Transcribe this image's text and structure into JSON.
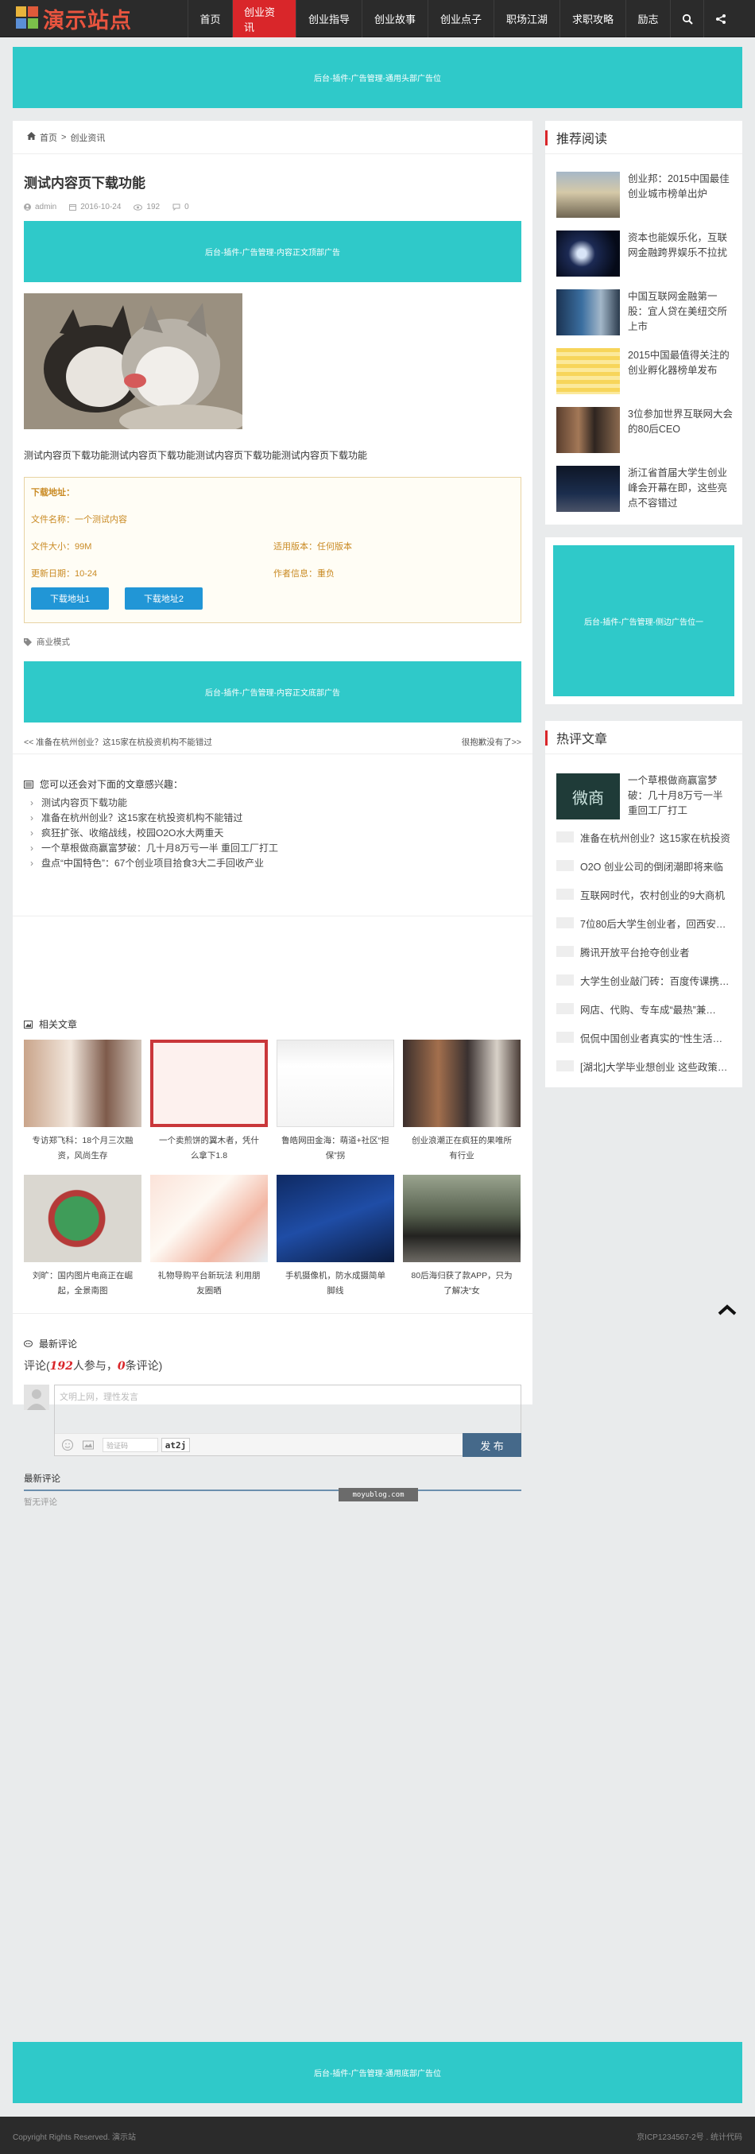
{
  "header": {
    "logo_text": "演示站点",
    "nav": [
      "首页",
      "创业资讯",
      "创业指导",
      "创业故事",
      "创业点子",
      "职场江湖",
      "求职攻略",
      "励志"
    ],
    "active_nav": "创业资讯"
  },
  "ads": {
    "top": "后台-插件-广告管理-通用头部广告位",
    "content_top": "后台-插件-广告管理-内容正文顶部广告",
    "content_bottom": "后台-插件-广告管理-内容正文底部广告",
    "side": "后台-插件-广告管理-侧边广告位一",
    "footer": "后台-插件-广告管理-通用底部广告位"
  },
  "breadcrumb": {
    "home": "首页",
    "sep": ">",
    "current": "创业资讯"
  },
  "article": {
    "title": "测试内容页下载功能",
    "author": "admin",
    "date": "2016-10-24",
    "views": "192",
    "comments": "0",
    "body": "测试内容页下载功能测试内容页下载功能测试内容页下载功能测试内容页下载功能"
  },
  "download": {
    "heading": "下载地址：",
    "name": "文件名称：一个测试内容",
    "size": "文件大小：99M",
    "version": "适用版本：任何版本",
    "updated": "更新日期：10-24",
    "author": "作者信息：重负",
    "btn1": "下载地址1",
    "btn2": "下载地址2"
  },
  "tag": "商业模式",
  "prev_next": {
    "prev": "<< 准备在杭州创业？这15家在杭投资机构不能错过",
    "next": "很抱歉没有了>>"
  },
  "recommend": {
    "heading": "您可以还会对下面的文章感兴趣：",
    "items": [
      "测试内容页下载功能",
      "准备在杭州创业？这15家在杭投资机构不能错过",
      "疯狂扩张、收缩战线，校园O2O水大两重天",
      "一个草根做商赢富梦破：几十月8万亏一半 重回工厂打工",
      "盘点“中国特色”：67个创业项目拾食3大二手回收产业"
    ]
  },
  "related": {
    "heading": "相关文章",
    "items": [
      "专访郑飞科：18个月三次融资，风尚生存",
      "一个卖煎饼的翼木者，凭什么拿下1.8",
      "鲁皓网田金海：萌道+社区“担保”拐",
      "创业浪潮正在疯狂的果唯所有行业",
      "刘旷：国内图片电商正在崛起，全景南图",
      "礼物导购平台新玩法 利用朋友圈晒",
      "手机摄像机，防水成摄简单脚线",
      "80后海归获了款APP，只为了解决“女"
    ]
  },
  "comments": {
    "heading": "最新评论",
    "count_prefix": "评论(",
    "participants": "192",
    "mid": "人参与，",
    "count": "0",
    "suffix": "条评论)",
    "placeholder": "文明上网，理性发言",
    "captcha_label": "验证码",
    "captcha_code": "at2j",
    "submit": "发 布",
    "latest_heading": "最新评论",
    "empty": "暂无评论"
  },
  "sidebar": {
    "recommended_title": "推荐阅读",
    "recommended": [
      "创业邦：2015中国最佳创业城市榜单出炉",
      "资本也能娱乐化，互联网金融跨界娱乐不拉扰",
      "中国互联网金融第一股：宜人贷在美纽交所上市",
      "2015中国最值得关注的创业孵化器榜单发布",
      "3位参加世界互联网大会的80后CEO",
      "浙江省首届大学生创业峰会开幕在即，这些亮点不容错过"
    ],
    "hot_title": "热评文章",
    "hot_top": "一个草根做商赢富梦破：几十月8万亏一半 重回工厂打工",
    "hot_top_thumb_text": "微商",
    "hot": [
      "准备在杭州创业？这15家在杭投资",
      "O2O 创业公司的倒闭潮即将来临",
      "互联网时代，农村创业的9大商机",
      "7位80后大学生创业者，回西安…",
      "腾讯开放平台抢夺创业者",
      "大学生创业敲门砖：百度传课携…",
      "网店、代购、专车成“最热”兼…",
      "侃侃中国创业者真实的“性生活…",
      "[湖北]大学毕业想创业 这些政策…"
    ]
  },
  "watermark": "moyublog.com",
  "footer": {
    "left": "Copyright Rights Reserved. 演示站",
    "right": "京ICP1234567-2号 . 统计代码"
  },
  "colors": {
    "accent": "#d9262a",
    "ad": "#2fc9c9",
    "download_btn": "#2196d6",
    "submit": "#45698a"
  }
}
